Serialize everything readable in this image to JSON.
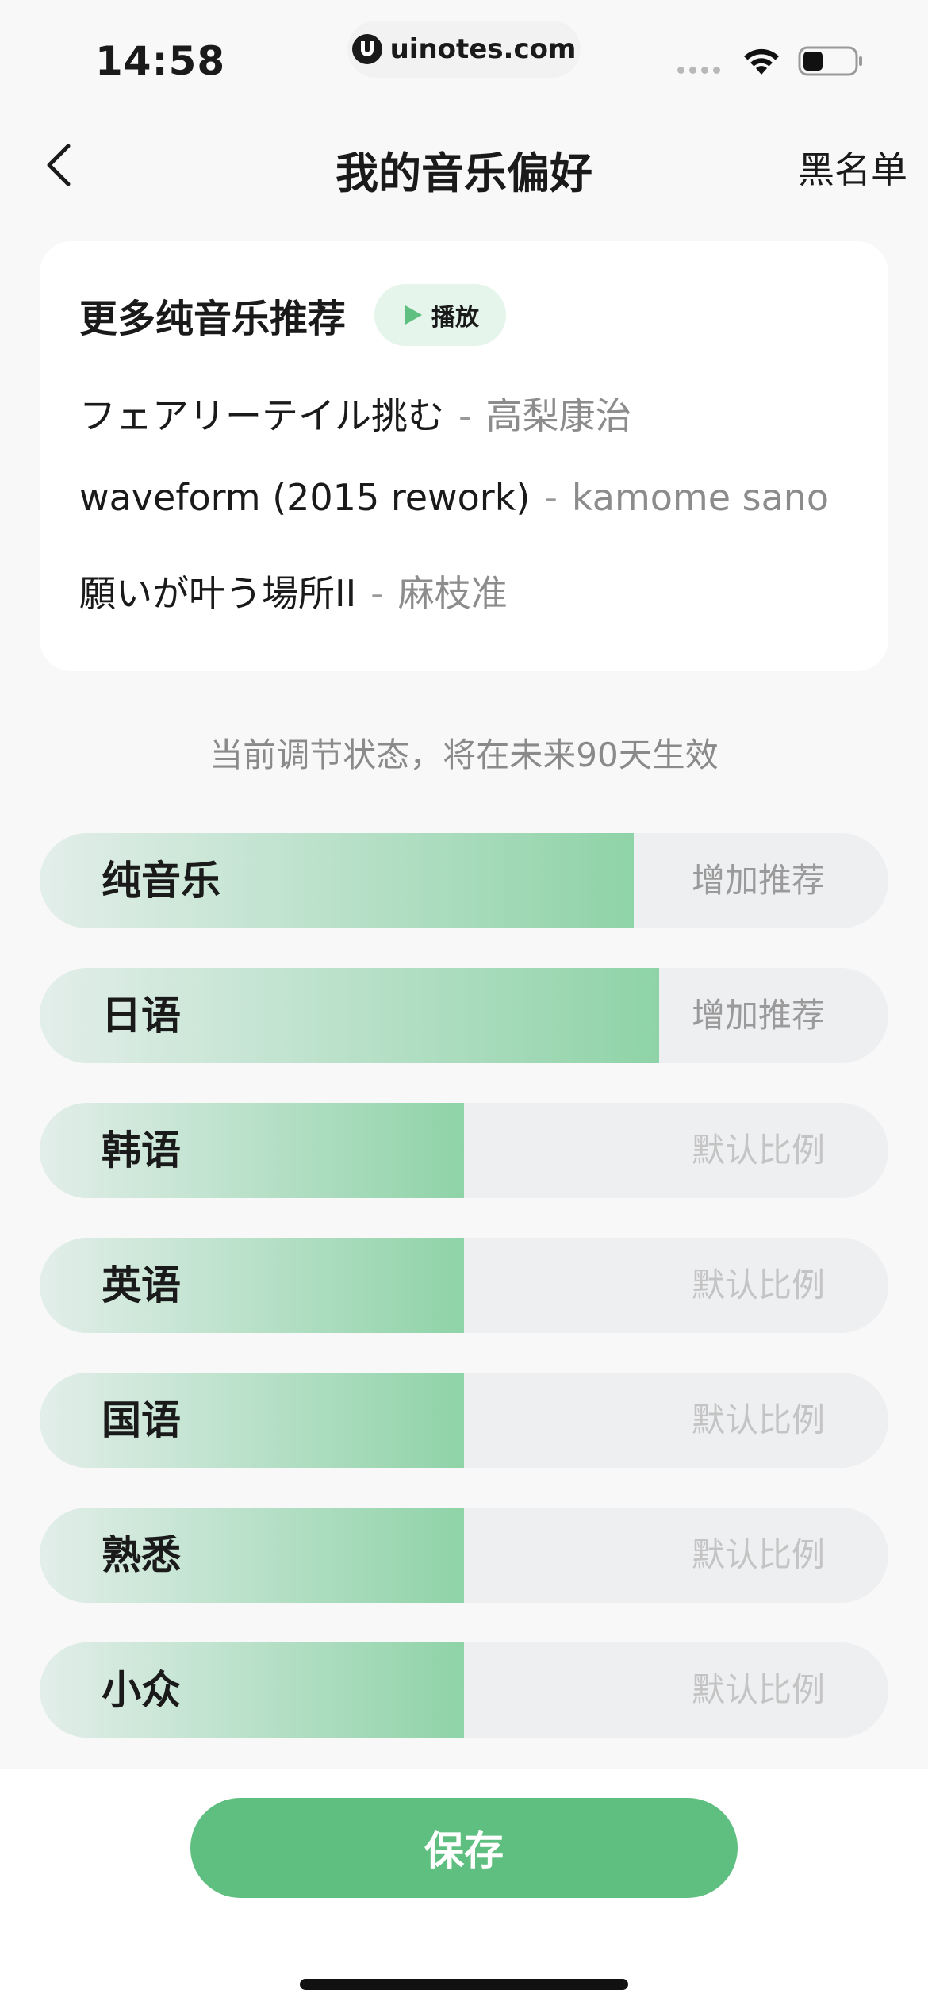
{
  "status_bar": {
    "time": "14:58",
    "url": "uinotes.com"
  },
  "header": {
    "title": "我的音乐偏好",
    "blacklist_label": "黑名单"
  },
  "recommend": {
    "title": "更多纯音乐推荐",
    "play_label": "播放",
    "songs": [
      {
        "title": "フェアリーテイル挑む",
        "sep": "-",
        "artist": "高梨康治"
      },
      {
        "title": "waveform (2015 rework)",
        "sep": "-",
        "artist": "kamome sano"
      },
      {
        "title": "願いが叶う場所II",
        "sep": "-",
        "artist": "麻枝准"
      }
    ]
  },
  "hint": "当前调节状态，将在未来90天生效",
  "preferences": [
    {
      "label": "纯音乐",
      "level": 0.7,
      "status": "增加推荐",
      "boosted": true
    },
    {
      "label": "日语",
      "level": 0.73,
      "status": "增加推荐",
      "boosted": true
    },
    {
      "label": "韩语",
      "level": 0.5,
      "status": "默认比例",
      "boosted": false
    },
    {
      "label": "英语",
      "level": 0.5,
      "status": "默认比例",
      "boosted": false
    },
    {
      "label": "国语",
      "level": 0.5,
      "status": "默认比例",
      "boosted": false
    },
    {
      "label": "熟悉",
      "level": 0.5,
      "status": "默认比例",
      "boosted": false
    },
    {
      "label": "小众",
      "level": 0.5,
      "status": "默认比例",
      "boosted": false
    }
  ],
  "footer": {
    "save_label": "保存"
  },
  "colors": {
    "accent": "#5fbf80",
    "fill_start": "#e3eeea",
    "fill_end": "#8fd3a8",
    "track": "#eeeff1",
    "status_boosted": "#9a9a9a",
    "status_default": "#c4c4c4"
  }
}
